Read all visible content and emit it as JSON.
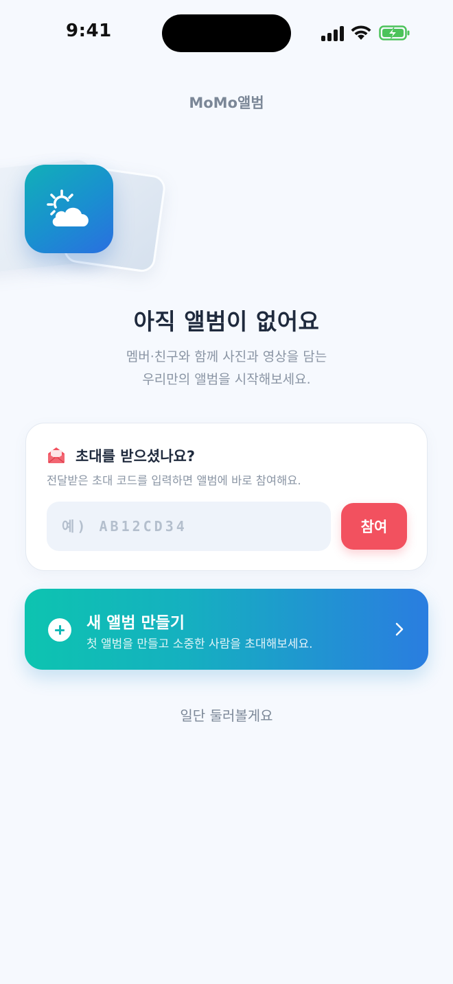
{
  "status_bar": {
    "time": "9:41"
  },
  "app": {
    "title": "MoMo앨범"
  },
  "empty_state": {
    "title": "아직 앨범이 없어요",
    "desc_line1": "멤버·친구와 함께 사진과 영상을 담는",
    "desc_line2": "우리만의 앨범을 시작해보세요."
  },
  "invite": {
    "title": "초대를 받으셨나요?",
    "desc": "전달받은 초대 코드를 입력하면 앨범에 바로 참여해요.",
    "code_placeholder": "예) AB12CD34",
    "code_value": "",
    "join_label": "참여"
  },
  "create": {
    "title": "새 앨범 만들기",
    "desc": "첫 앨범을 만들고 소중한 사람을 초대해보세요."
  },
  "browse_label": "일단 둘러볼게요",
  "icons": {
    "app_icon": "sun-cloud-icon",
    "invite": "envelope-open-icon",
    "create": "plus-circle-icon",
    "create_arrow": "chevron-right-icon"
  },
  "colors": {
    "background": "#f6f9fe",
    "accent_red": "#f2515f",
    "gradient_start": "#0dc4b0",
    "gradient_end": "#2a7de0",
    "text_primary": "#1f2a3d",
    "text_secondary": "#8a95a4"
  }
}
